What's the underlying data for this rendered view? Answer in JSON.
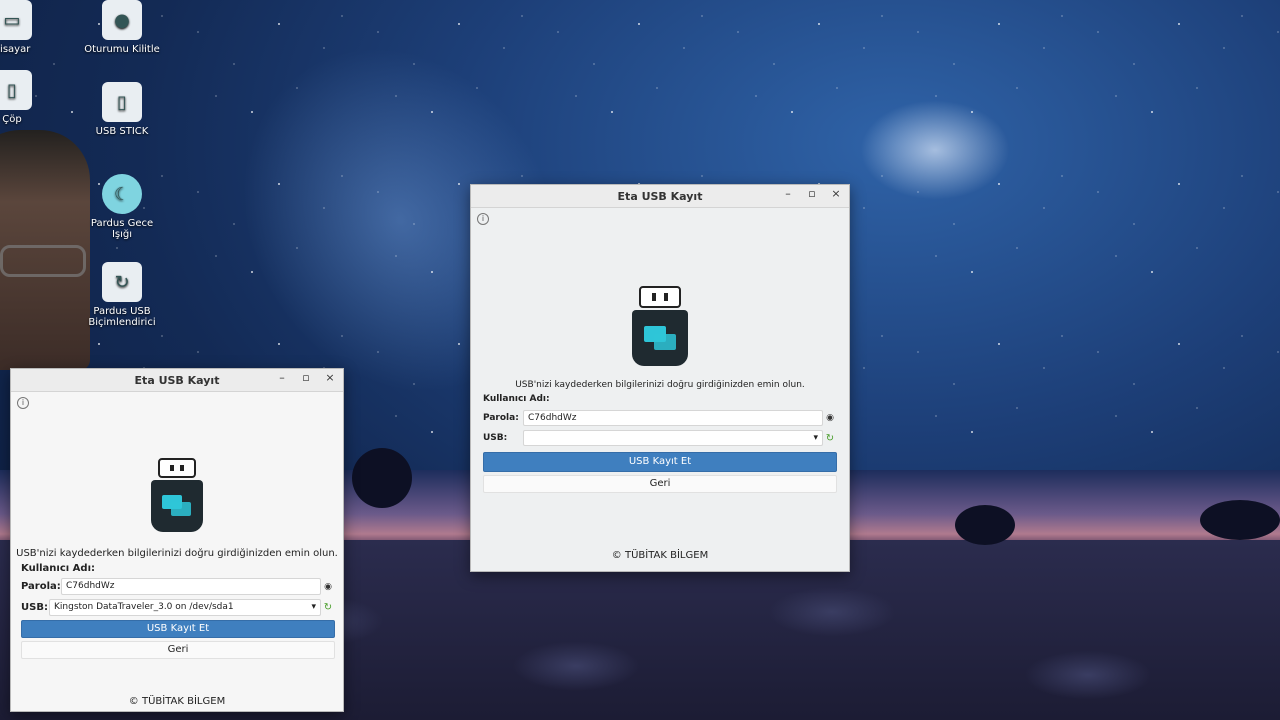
{
  "desktop": {
    "icons": [
      {
        "label": "gisayar"
      },
      {
        "label": "Oturumu Kilitle"
      },
      {
        "label": "Çöp"
      },
      {
        "label": "USB STICK"
      },
      {
        "label": "Pardus Gece Işığı"
      },
      {
        "label": "Pardus USB Biçimlendirici"
      }
    ]
  },
  "window_large": {
    "title": "Eta USB Kayıt",
    "message": "USB'nizi kaydederken bilgilerinizi doğru girdiğinizden emin olun.",
    "username_label": "Kullanıcı Adı:",
    "password_label": "Parola:",
    "password_value": "C76dhdWz",
    "usb_label": "USB:",
    "usb_value": "",
    "primary_button": "USB Kayıt Et",
    "secondary_button": "Geri",
    "footer": "© TÜBİTAK BİLGEM"
  },
  "window_small": {
    "title": "Eta USB Kayıt",
    "message": "USB'nizi kaydederken bilgilerinizi doğru girdiğinizden emin olun.",
    "username_label": "Kullanıcı Adı:",
    "password_label": "Parola:",
    "password_value": "C76dhdWz",
    "usb_label": "USB:",
    "usb_value": "Kingston DataTraveler_3.0 on /dev/sda1",
    "primary_button": "USB Kayıt Et",
    "secondary_button": "Geri",
    "footer": "© TÜBİTAK BİLGEM"
  },
  "controls": {
    "minimize": "–",
    "maximize": "▫",
    "close": "×",
    "info": "i",
    "eye": "◉",
    "refresh": "↻",
    "dropdown": "▾"
  },
  "colors": {
    "accent": "#3f7fbf",
    "usb_screen": "#2ec5d8",
    "usb_body": "#1f2a30"
  }
}
